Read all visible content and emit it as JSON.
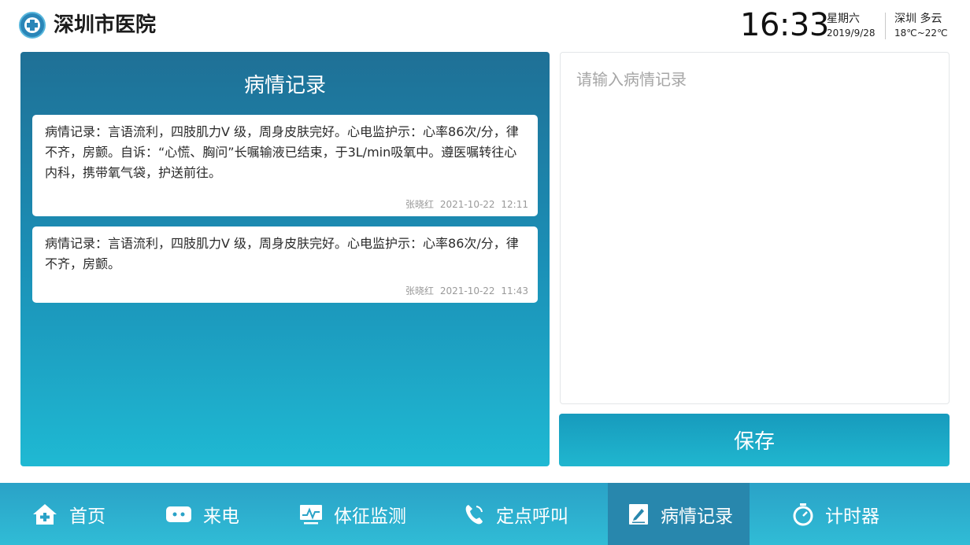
{
  "header": {
    "hospital_name": "深圳市医院",
    "time": "16:33",
    "weekday": "星期六",
    "date": "2019/9/28",
    "weather": "深圳 多云",
    "temperature": "18℃~22℃"
  },
  "records_panel": {
    "title": "病情记录",
    "records": [
      {
        "text": "病情记录：言语流利，四肢肌力V 级，周身皮肤完好。心电监护示：心率86次/分，律不齐，房颤。自诉：“心慌、胸问”长嘱输液已结束，于3L/min吸氧中。遵医嘱转往心内科，携带氧气袋，护送前往。",
        "author": "张晓红",
        "date": "2021-10-22",
        "time": "12:11"
      },
      {
        "text": "病情记录：言语流利，四肢肌力V 级，周身皮肤完好。心电监护示：心率86次/分，律不齐，房颤。",
        "author": "张晓红",
        "date": "2021-10-22",
        "time": "11:43"
      }
    ]
  },
  "editor": {
    "placeholder": "请输入病情记录",
    "value": ""
  },
  "save_label": "保存",
  "nav": {
    "active": "病情记录",
    "items": [
      {
        "label": "首页",
        "icon": "home-icon"
      },
      {
        "label": "来电",
        "icon": "chat-icon"
      },
      {
        "label": "体征监测",
        "icon": "monitor-icon"
      },
      {
        "label": "定点呼叫",
        "icon": "phone-icon"
      },
      {
        "label": "病情记录",
        "icon": "edit-icon"
      },
      {
        "label": "计时器",
        "icon": "stopwatch-icon"
      }
    ]
  },
  "colors": {
    "panel_top": "#1f7096",
    "panel_bottom": "#1fb9d3",
    "nav_bg": "#2aa2c7",
    "nav_active": "#2887ad",
    "save_button": "#179bbd"
  }
}
